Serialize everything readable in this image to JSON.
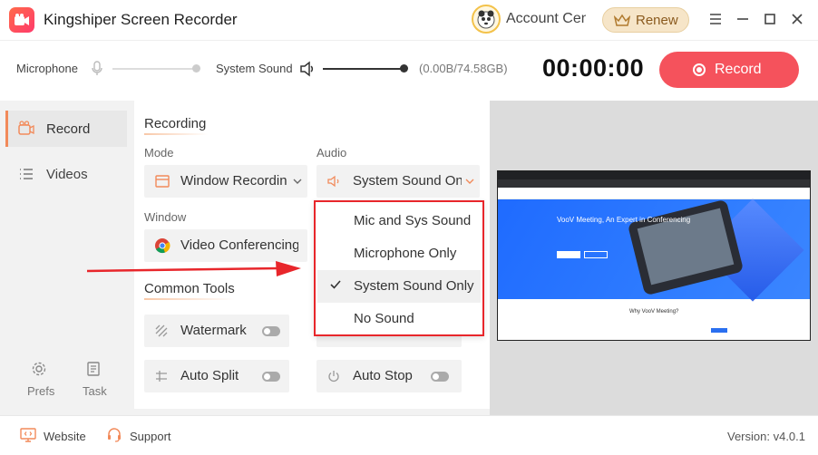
{
  "app": {
    "title": "Kingshiper Screen Recorder"
  },
  "header": {
    "account_label": "Account Center",
    "renew_label": "Renew"
  },
  "recbar": {
    "mic_label": "Microphone",
    "system_sound_label": "System Sound",
    "storage": "(0.00B/74.58GB)",
    "timer": "00:00:00",
    "record_label": "Record"
  },
  "sidebar": {
    "items": [
      {
        "label": "Record",
        "icon": "camera-icon",
        "active": true
      },
      {
        "label": "Videos",
        "icon": "list-icon",
        "active": false
      }
    ],
    "prefs_label": "Prefs",
    "task_label": "Task"
  },
  "recording": {
    "title": "Recording",
    "mode_label": "Mode",
    "mode_value": "Window Recording",
    "audio_label": "Audio",
    "audio_value": "System Sound Only",
    "window_label": "Window",
    "window_value": "Video Conferencing"
  },
  "tools": {
    "title": "Common Tools",
    "items": [
      {
        "label": "Watermark",
        "on": false
      },
      {
        "label": "Auto Split",
        "on": false
      },
      {
        "label": "Auto Stop",
        "on": false
      }
    ]
  },
  "audio_dropdown": {
    "options": [
      "Mic and Sys Sound",
      "Microphone Only",
      "System Sound Only",
      "No Sound"
    ],
    "selected": "System Sound Only"
  },
  "preview": {
    "hero_title": "VooV Meeting, An Expert in Conferencing",
    "section_title": "Why VooV Meeting?"
  },
  "footer": {
    "website_label": "Website",
    "support_label": "Support",
    "version": "Version: v4.0.1"
  },
  "colors": {
    "accent": "#f5525c",
    "highlight": "#e8262b",
    "renew_bg": "#f6e5c8"
  }
}
